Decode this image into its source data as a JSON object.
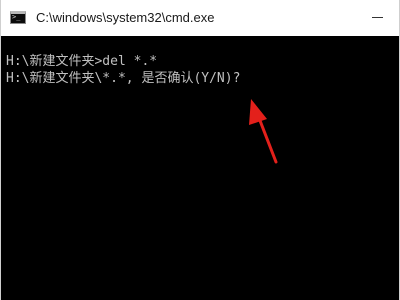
{
  "window": {
    "title": "C:\\windows\\system32\\cmd.exe",
    "icon": "cmd-icon"
  },
  "console": {
    "lines": [
      "H:\\新建文件夹>del *.*",
      "H:\\新建文件夹\\*.*, 是否确认(Y/N)?"
    ]
  },
  "colors": {
    "console_background": "#000000",
    "console_text": "#c0c0c0",
    "annotation_arrow": "#e3201b"
  }
}
